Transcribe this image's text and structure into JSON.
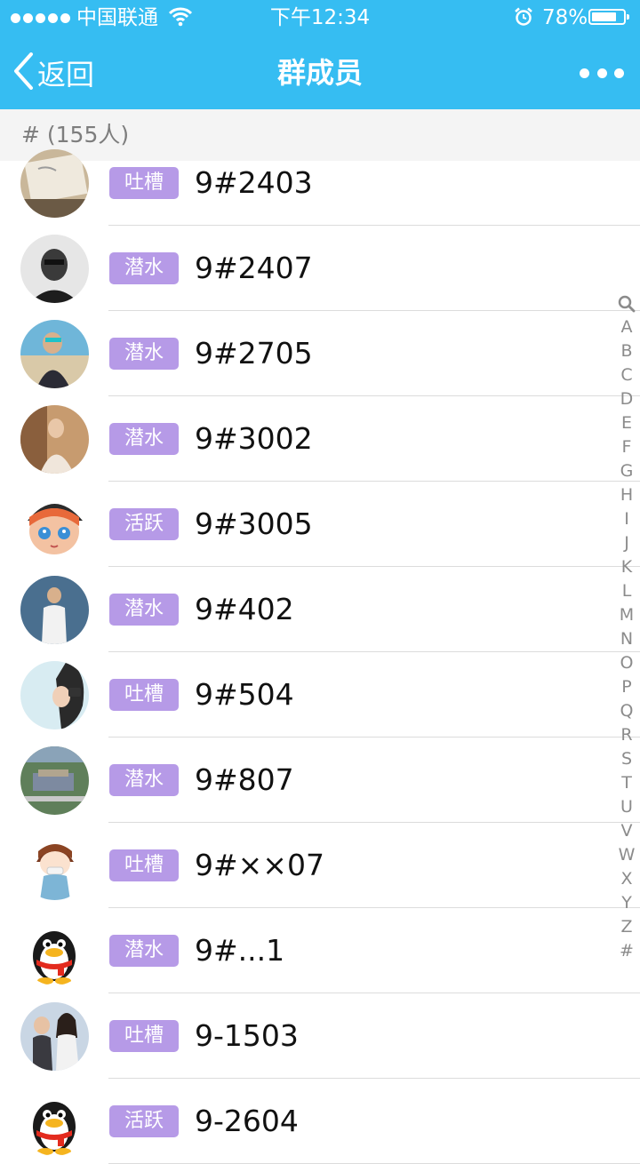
{
  "status_bar": {
    "carrier": "中国联通",
    "time": "下午12:34",
    "battery_percent": "78%",
    "battery_level": 0.78,
    "signal_bars": 5
  },
  "nav": {
    "back_label": "返回",
    "title": "群成员",
    "more_icon": "more-dots-icon"
  },
  "section": {
    "header": "# (155人)"
  },
  "badge_colors": {
    "background": "#b69ae7",
    "text": "#ffffff"
  },
  "accent": "#36bdf2",
  "members": [
    {
      "badge": "吐槽",
      "name": "9#2403",
      "avatar": "book-photo"
    },
    {
      "badge": "潜水",
      "name": "9#2407",
      "avatar": "man-bw-photo"
    },
    {
      "badge": "潜水",
      "name": "9#2705",
      "avatar": "beach-couple-photo"
    },
    {
      "badge": "潜水",
      "name": "9#3002",
      "avatar": "woman-portrait-photo"
    },
    {
      "badge": "活跃",
      "name": "9#3005",
      "avatar": "anime-girl"
    },
    {
      "badge": "潜水",
      "name": "9#402",
      "avatar": "man-standing-photo"
    },
    {
      "badge": "吐槽",
      "name": "9#504",
      "avatar": "woman-camera-photo"
    },
    {
      "badge": "潜水",
      "name": "9#807",
      "avatar": "aerial-building-photo"
    },
    {
      "badge": "吐槽",
      "name": "9#××07",
      "avatar": "cartoon-boy"
    },
    {
      "badge": "潜水",
      "name": "9#...1",
      "avatar": "qq-penguin"
    },
    {
      "badge": "吐槽",
      "name": "9-1503",
      "avatar": "couple-photo"
    },
    {
      "badge": "活跃",
      "name": "9-2604",
      "avatar": "qq-penguin"
    }
  ],
  "index_letters": [
    "A",
    "B",
    "C",
    "D",
    "E",
    "F",
    "G",
    "H",
    "I",
    "J",
    "K",
    "L",
    "M",
    "N",
    "O",
    "P",
    "Q",
    "R",
    "S",
    "T",
    "U",
    "V",
    "W",
    "X",
    "Y",
    "Z",
    "#"
  ]
}
